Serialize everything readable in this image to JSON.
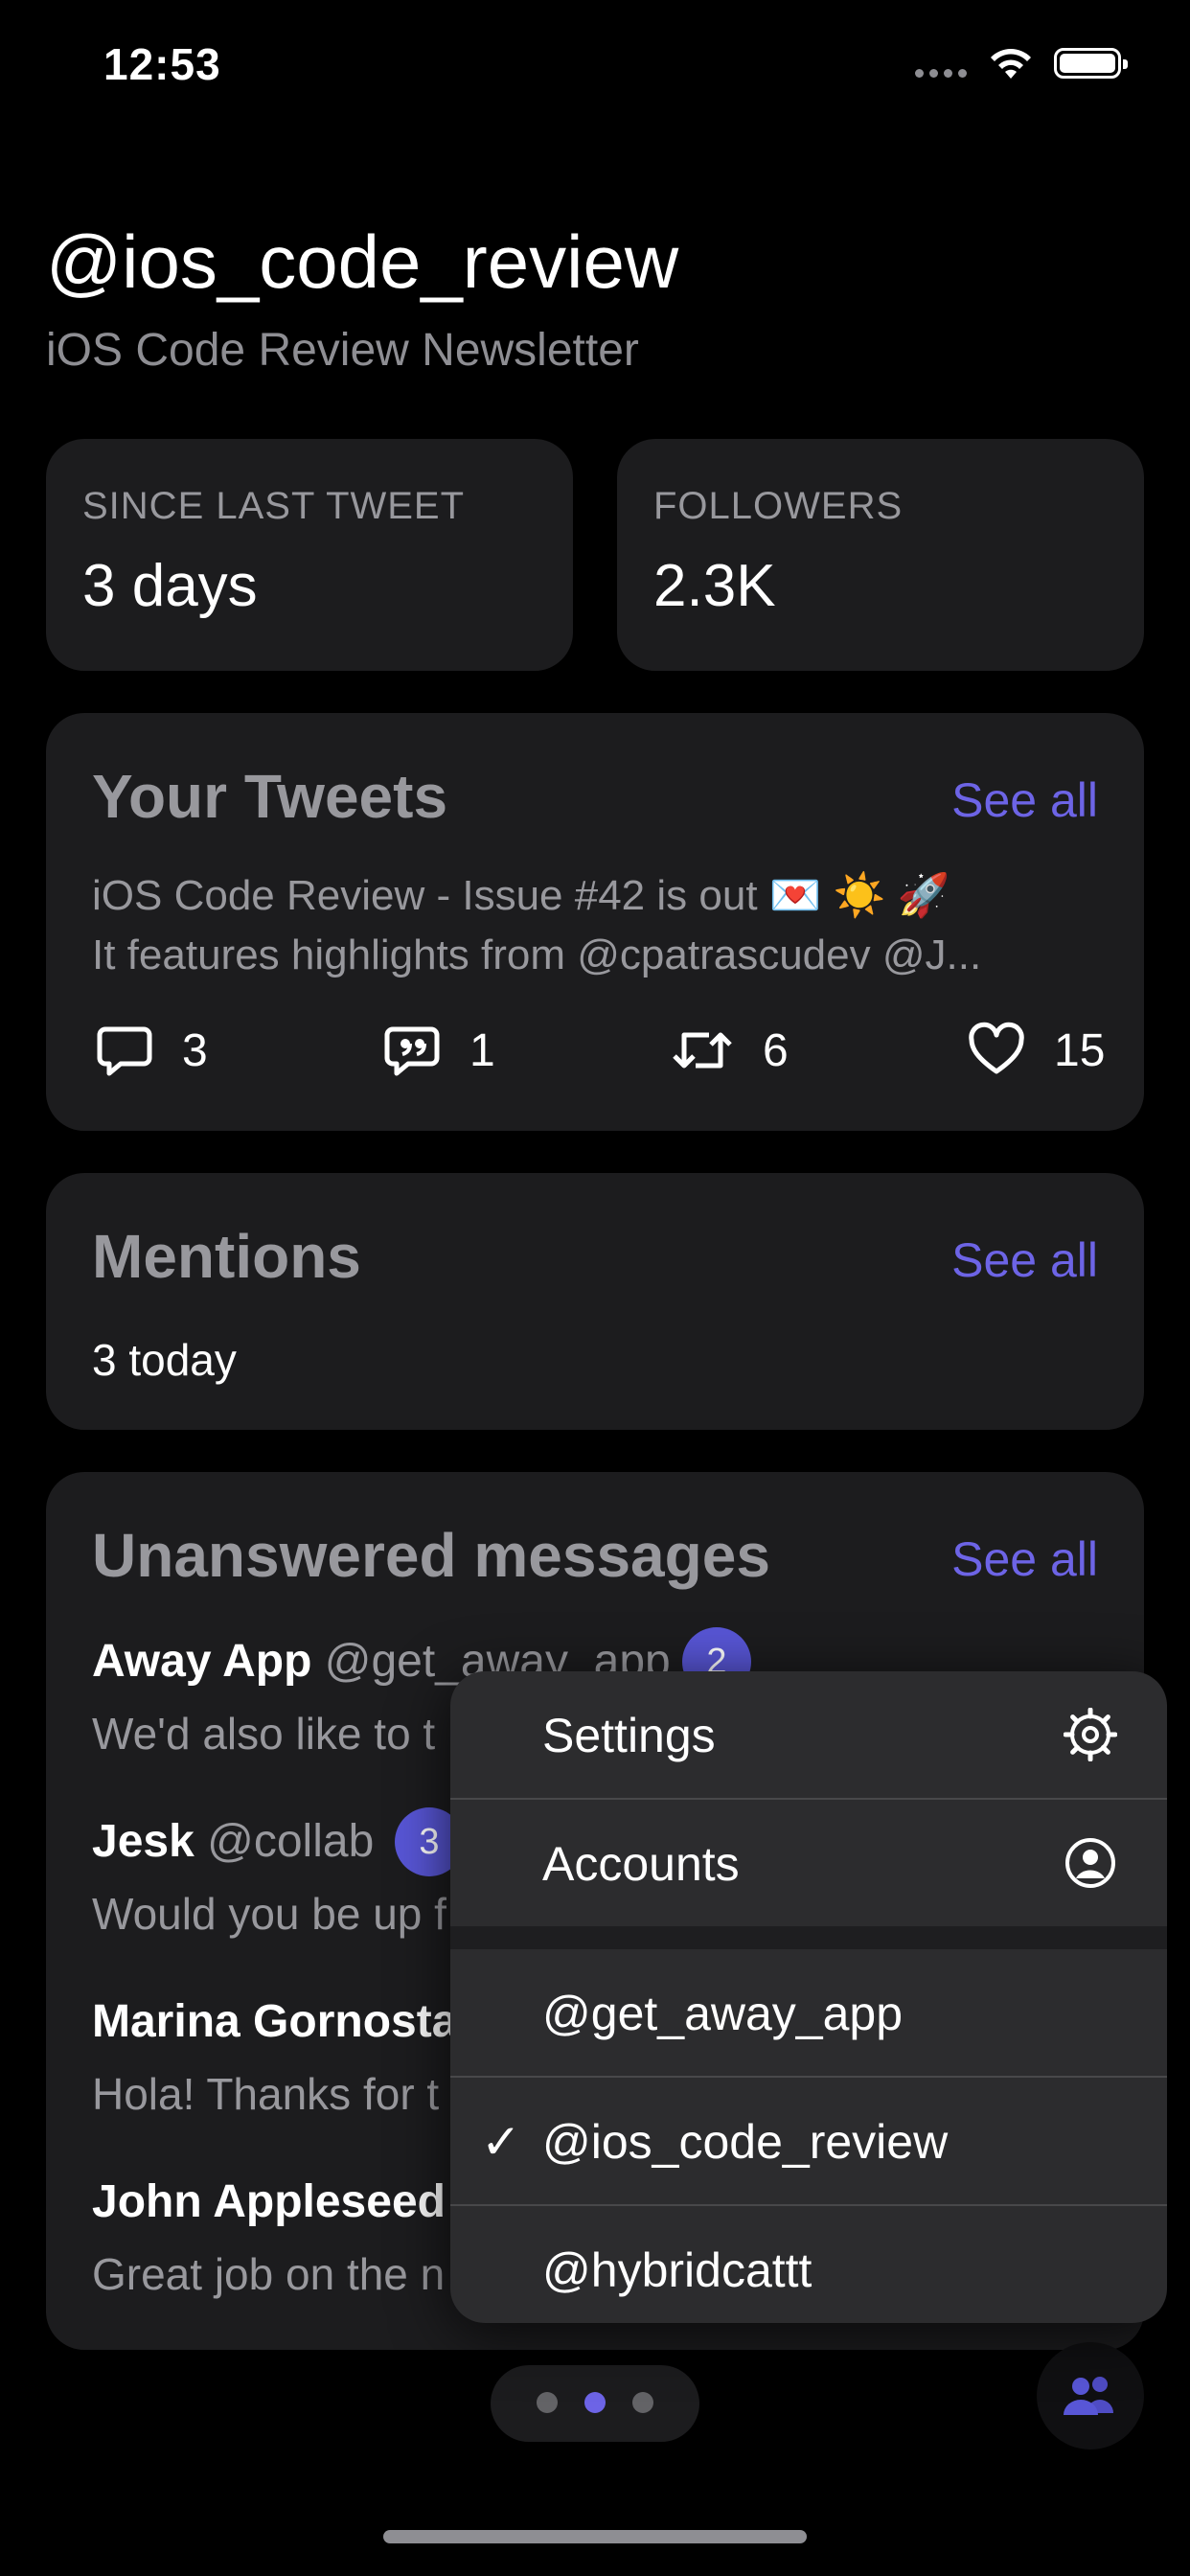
{
  "status_bar": {
    "time": "12:53"
  },
  "header": {
    "handle": "@ios_code_review",
    "subtitle": "iOS Code Review Newsletter"
  },
  "stats": [
    {
      "label": "SINCE LAST TWEET",
      "value": "3 days"
    },
    {
      "label": "FOLLOWERS",
      "value": "2.3K"
    }
  ],
  "tweets": {
    "title": "Your Tweets",
    "see_all": "See all",
    "line1": "iOS Code Review - Issue #42 is out  💌 ☀️ 🚀",
    "line2": "It features highlights from @cpatrascudev @J...",
    "metrics": {
      "replies": "3",
      "quotes": "1",
      "retweets": "6",
      "likes": "15"
    }
  },
  "mentions": {
    "title": "Mentions",
    "see_all": "See all",
    "summary": "3 today"
  },
  "messages": {
    "title": "Unanswered messages",
    "see_all": "See all",
    "items": [
      {
        "name": "Away App",
        "username": "@get_away_app",
        "badge": "2",
        "preview": "We'd also like to t"
      },
      {
        "name": "Jesk",
        "username": "@collab",
        "badge": "3",
        "preview": "Would you be up f"
      },
      {
        "name": "Marina Gornosta",
        "username": "",
        "badge": "",
        "preview": "Hola! Thanks for t"
      },
      {
        "name": "John Appleseed",
        "username": "",
        "badge": "",
        "preview": "Great job on the n"
      }
    ]
  },
  "menu": {
    "settings": "Settings",
    "accounts": "Accounts",
    "account_list": [
      "@get_away_app",
      "@ios_code_review",
      "@hybridcattt"
    ],
    "selected_account": "@ios_code_review",
    "checkmark": "✓"
  },
  "colors": {
    "accent": "#6d64e6",
    "badge": "#5856d6",
    "card": "#1c1c1e",
    "menu": "#2c2c2e"
  },
  "pager": {
    "pages": 3,
    "current": 2
  }
}
